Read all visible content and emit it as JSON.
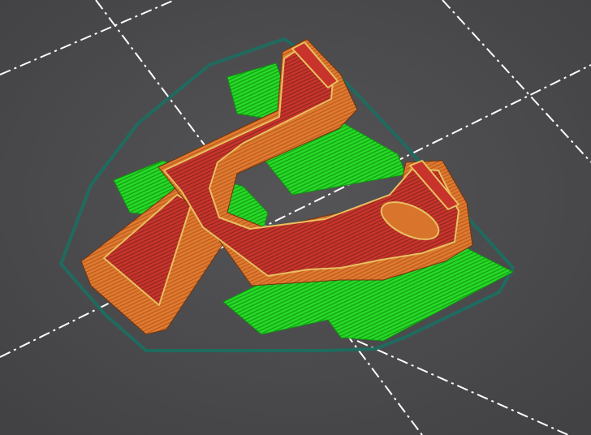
{
  "viewport": {
    "view": "3d-slice-preview",
    "colors": {
      "background": "#4b4b4d",
      "grid": "#ffffff",
      "skirt": "#1f6b5f",
      "support": "#22d522",
      "support_dark": "#129012",
      "perimeter": "#e0782e",
      "perimeter_dark": "#a24e18",
      "top_solid": "#c8312a",
      "inner_perimeter": "#e8c060"
    }
  }
}
